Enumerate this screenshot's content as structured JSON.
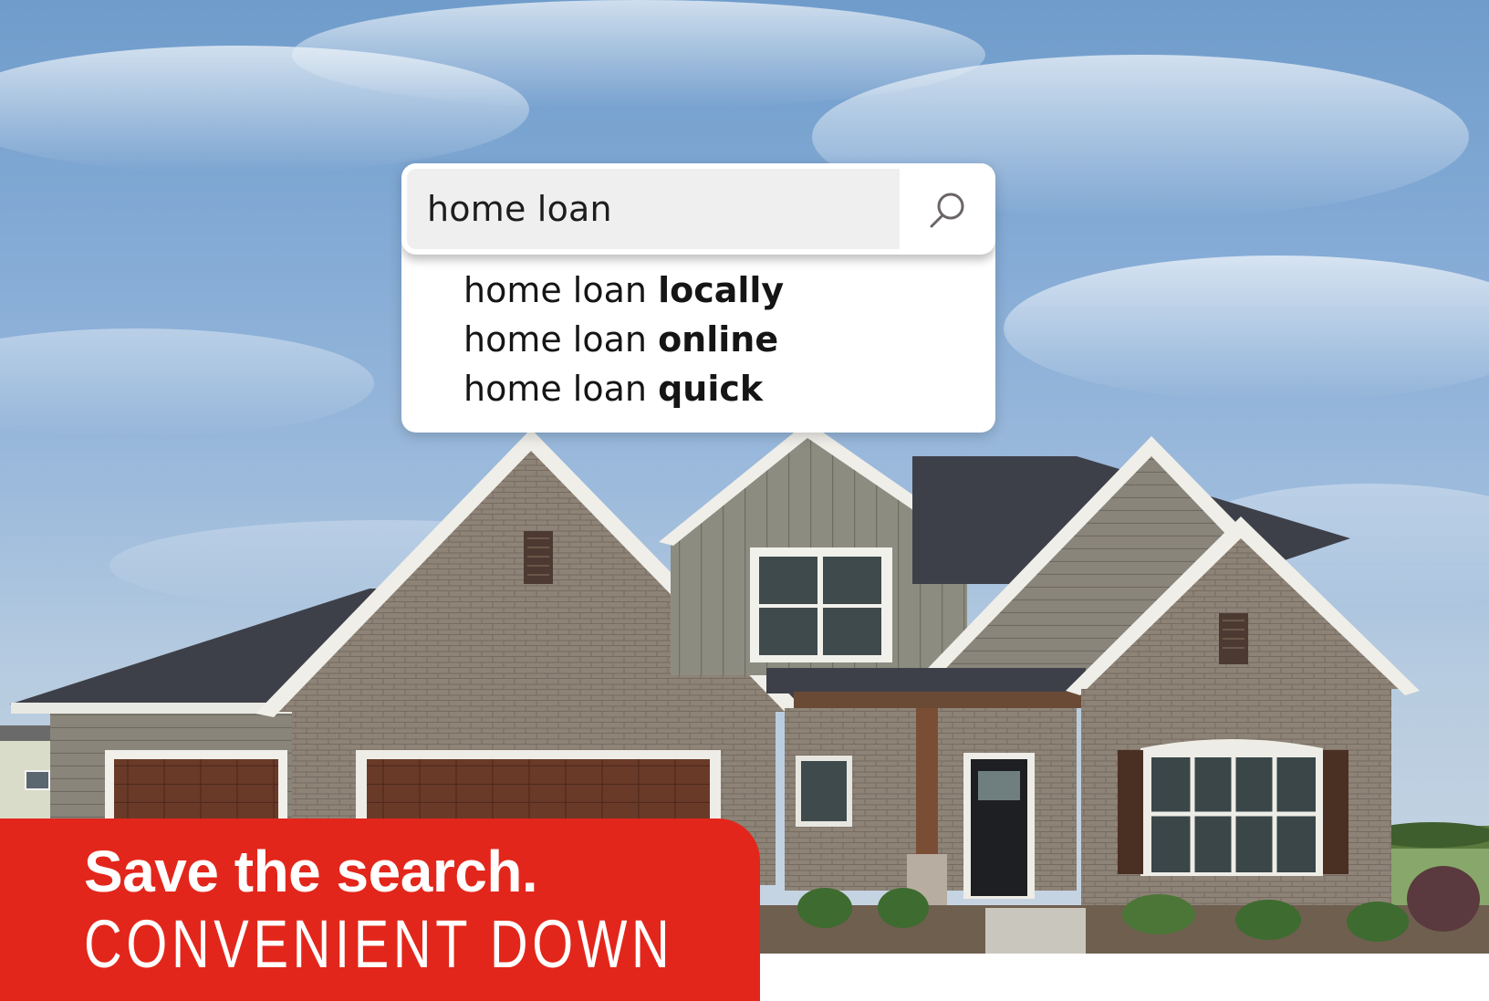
{
  "search": {
    "query": "home loan",
    "button_icon": "search-icon",
    "suggestions": [
      {
        "prefix": "home loan ",
        "completion": "locally"
      },
      {
        "prefix": "home loan ",
        "completion": "online"
      },
      {
        "prefix": "home loan ",
        "completion": "quick"
      }
    ]
  },
  "banner": {
    "headline": "Save the search.",
    "subhead": "CONVENIENT DOWN"
  },
  "colors": {
    "banner_red": "#e3261b",
    "sky_blue": "#86acd6",
    "brick": "#8f8478",
    "roof": "#3e4049"
  }
}
